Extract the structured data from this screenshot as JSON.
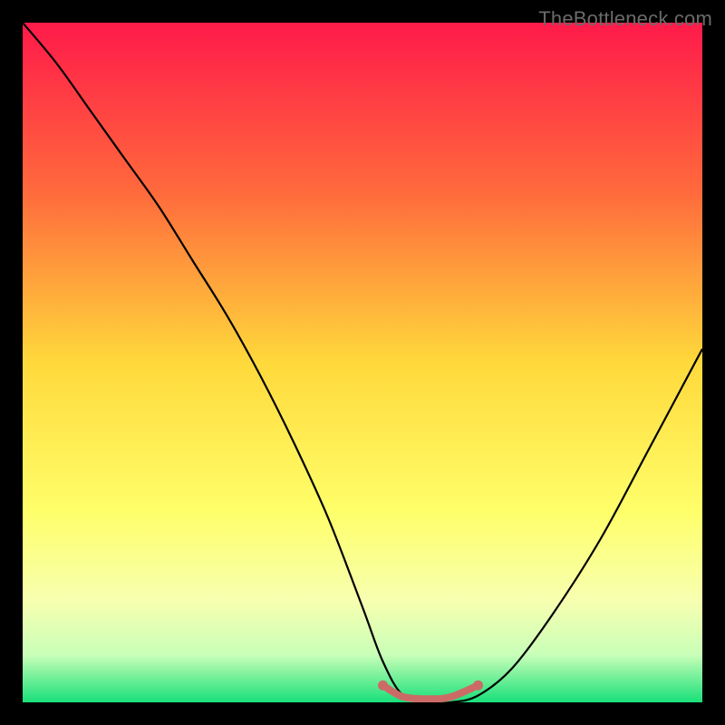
{
  "watermark": "TheBottleneck.com",
  "chart_data": {
    "type": "line",
    "title": "",
    "xlabel": "",
    "ylabel": "",
    "xlim": [
      0,
      100
    ],
    "ylim": [
      0,
      100
    ],
    "grid": false,
    "legend": false,
    "gradient_stops": [
      {
        "offset": 0,
        "color": "#ff1a4a"
      },
      {
        "offset": 25,
        "color": "#ff6a3c"
      },
      {
        "offset": 50,
        "color": "#ffd93b"
      },
      {
        "offset": 72,
        "color": "#ffff6a"
      },
      {
        "offset": 85,
        "color": "#f7ffb0"
      },
      {
        "offset": 93,
        "color": "#c9ffb8"
      },
      {
        "offset": 100,
        "color": "#18e07a"
      }
    ],
    "series": [
      {
        "name": "bottleneck-curve",
        "x": [
          0,
          5,
          10,
          15,
          20,
          25,
          30,
          35,
          40,
          45,
          50,
          53,
          56,
          60,
          63,
          67,
          72,
          78,
          85,
          92,
          100
        ],
        "y": [
          100,
          94,
          87,
          80,
          73,
          65,
          57,
          48,
          38,
          27,
          14,
          6,
          1,
          0,
          0,
          1,
          5,
          13,
          24,
          37,
          52
        ]
      },
      {
        "name": "flat-region-marker",
        "x": [
          53,
          56,
          60,
          63,
          67
        ],
        "y": [
          2.5,
          0.8,
          0.5,
          0.8,
          2.5
        ]
      }
    ],
    "flat_region": {
      "x_start": 53,
      "x_end": 67,
      "y": 1
    }
  }
}
